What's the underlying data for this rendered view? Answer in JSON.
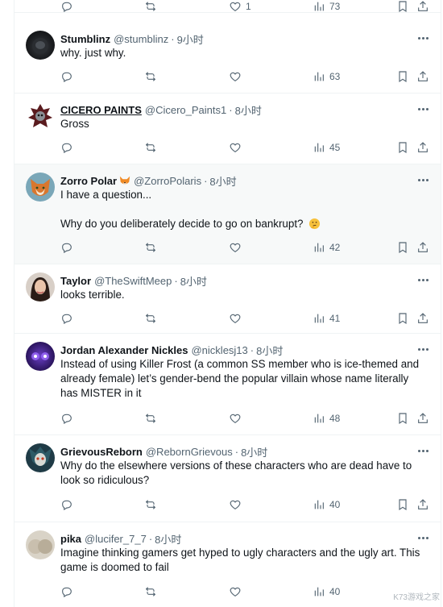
{
  "top_row": {
    "like_count": "1",
    "views": "73"
  },
  "tweets": [
    {
      "name": "Stumblinz",
      "handle": "@stumblinz",
      "time": "9小时",
      "lines": [
        "why. just why."
      ],
      "views": "63"
    },
    {
      "name": "CICERO PAINTS",
      "handle": "@Cicero_Paints1",
      "time": "8小时",
      "lines": [
        "Gross"
      ],
      "views": "45"
    },
    {
      "name": "Zorro Polar",
      "handle": "@ZorroPolaris",
      "time": "8小时",
      "lines": [
        "I have a question...",
        "Why do you deliberately decide to go on bankrupt?"
      ],
      "views": "42"
    },
    {
      "name": "Taylor",
      "handle": "@TheSwiftMeep",
      "time": "8小时",
      "lines": [
        "looks terrible."
      ],
      "views": "41"
    },
    {
      "name": "Jordan Alexander Nickles",
      "handle": "@nicklesj13",
      "time": "8小时",
      "lines": [
        "Instead of using Killer Frost (a common SS member who is ice-themed and already female) let’s gender-bend the popular villain whose name literally has MISTER in it"
      ],
      "views": "48"
    },
    {
      "name": "GrievousReborn",
      "handle": "@RebornGrievous",
      "time": "8小时",
      "lines": [
        "Why do the elsewhere versions of these characters who are dead have to look so ridiculous?"
      ],
      "views": "40"
    },
    {
      "name": "pika",
      "handle": "@lucifer_7_7",
      "time": "8小时",
      "lines": [
        "Imagine thinking gamers get hyped to ugly characters and the ugly art. This game is doomed to fail"
      ],
      "views": "40"
    }
  ],
  "dot": "·",
  "watermark": "K73游戏之家"
}
